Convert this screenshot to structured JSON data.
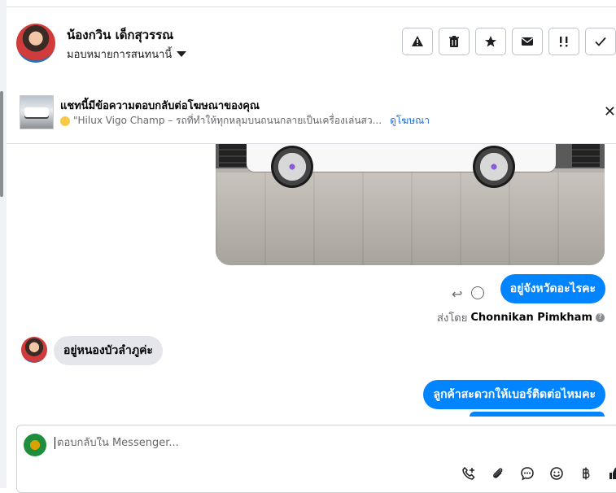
{
  "header": {
    "contact_name": "น้องกวิน เด็กสุวรรณ",
    "assign_label": "มอบหมายการสนทนานี้",
    "actions": [
      "alert",
      "delete",
      "star",
      "mail",
      "mark-unread",
      "done"
    ]
  },
  "ad_banner": {
    "title": "แชทนี้มีข้อความตอบกลับต่อโฆษณาของคุณ",
    "ad_text": "\"Hilux Vigo Champ – รถที่ทำให้ทุกหลุมบนถนนกลายเป็นเครื่องเล่นสว...",
    "link_label": "ดูโฆษณา",
    "close_label": "✕"
  },
  "messages": [
    {
      "direction": "out",
      "text": "อยู่จังหวัดอะไรคะ"
    },
    {
      "direction": "in",
      "text": "อยู่หนองบัวลำภูค่ะ"
    },
    {
      "direction": "out",
      "text": "ลูกค้าสะดวกให้เบอร์ติดต่อไหมคะ"
    }
  ],
  "sent_by": {
    "prefix": "ส่งโดย",
    "name": "Chonnikan Pimkham"
  },
  "composer": {
    "placeholder": "ตอบกลับใน Messenger..."
  },
  "colors": {
    "outgoing_bubble": "#0084ff",
    "incoming_bubble": "#e4e6eb",
    "link": "#216fdb"
  }
}
